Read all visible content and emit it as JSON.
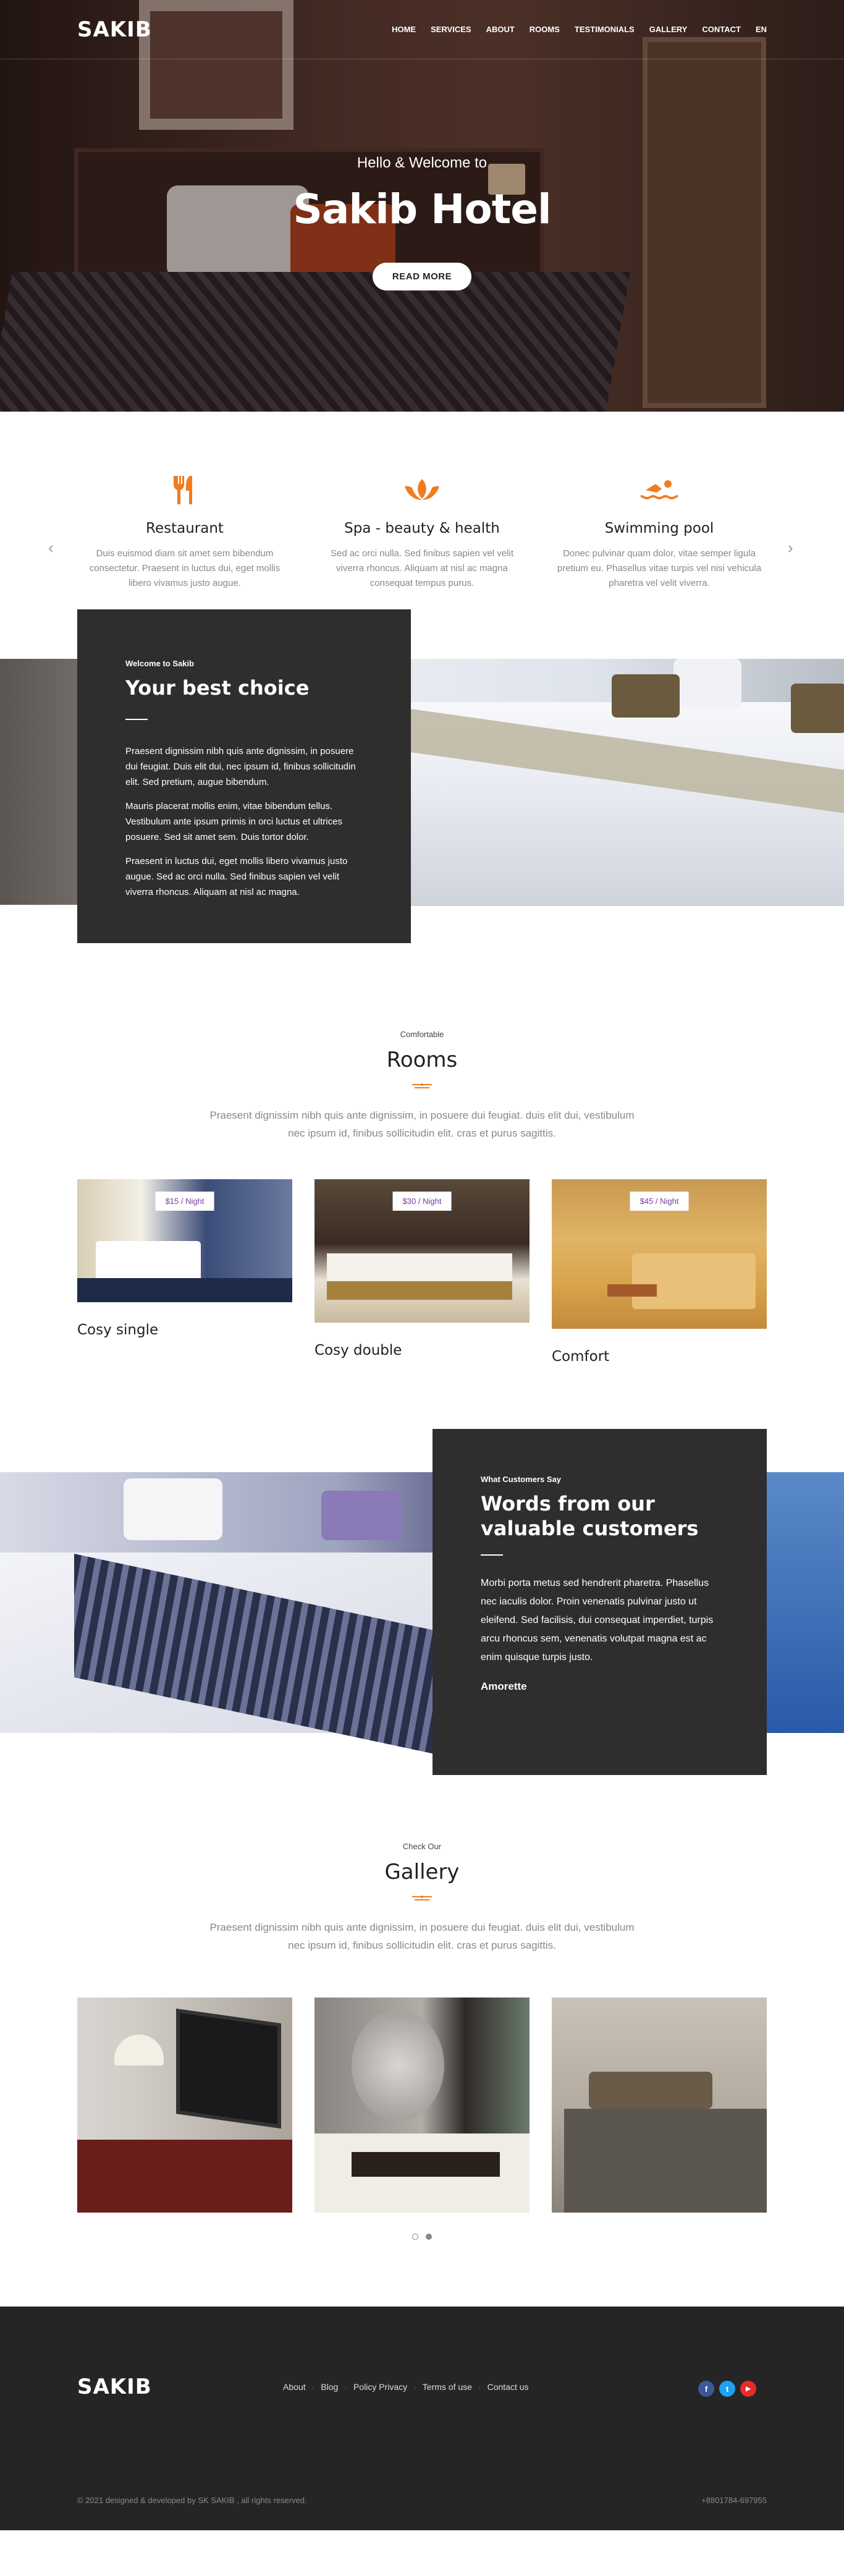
{
  "nav": {
    "logo": "SAKIB",
    "items": [
      "HOME",
      "SERVICES",
      "ABOUT",
      "ROOMS",
      "TESTIMONIALS",
      "GALLERY",
      "CONTACT",
      "EN"
    ]
  },
  "hero": {
    "subtitle": "Hello & Welcome to",
    "title": "Sakib Hotel",
    "button": "READ MORE"
  },
  "services": [
    {
      "icon": "fork-knife-icon",
      "title": "Restaurant",
      "text": "Duis euismod diam sit amet sem bibendum consectetur. Praesent in luctus dui, eget mollis libero vivamus justo augue."
    },
    {
      "icon": "lotus-icon",
      "title": "Spa - beauty & health",
      "text": "Sed ac orci nulla. Sed finibus sapien vel velit viverra rhoncus. Aliquam at nisl ac magna consequat tempus purus."
    },
    {
      "icon": "swimmer-icon",
      "title": "Swimming pool",
      "text": "Donec pulvinar quam dolor, vitae semper ligula pretium eu. Phasellus vitae turpis vel nisi vehicula pharetra vel velit viverra."
    }
  ],
  "about": {
    "small": "Welcome to Sakib",
    "title": "Your best choice",
    "paragraphs": [
      "Praesent dignissim nibh quis ante dignissim, in posuere dui feugiat. Duis elit dui, nec ipsum id, finibus sollicitudin elit. Sed pretium, augue bibendum.",
      "Mauris placerat mollis enim, vitae bibendum tellus. Vestibulum ante ipsum primis in orci luctus et ultrices posuere. Sed sit amet sem. Duis tortor dolor.",
      "Praesent in luctus dui, eget mollis libero vivamus justo augue. Sed ac orci nulla. Sed finibus sapien vel velit viverra rhoncus. Aliquam at nisl ac magna."
    ]
  },
  "rooms": {
    "small": "Comfortable",
    "title": "Rooms",
    "text": "Praesent dignissim nibh quis ante dignissim, in posuere dui feugiat. duis elit dui, vestibulum nec ipsum id, finibus sollicitudin elit. cras et purus sagittis.",
    "items": [
      {
        "price": "$15 / Night",
        "name": "Cosy single"
      },
      {
        "price": "$30 / Night",
        "name": "Cosy double"
      },
      {
        "price": "$45 / Night",
        "name": "Comfort"
      }
    ]
  },
  "testimonial": {
    "small": "What Customers Say",
    "title": "Words from our valuable customers",
    "text": "Morbi porta metus sed hendrerit pharetra. Phasellus nec iaculis dolor. Proin venenatis pulvinar justo ut eleifend. Sed facilisis, dui consequat imperdiet, turpis arcu rhoncus sem, venenatis volutpat magna est ac enim quisque turpis justo.",
    "author": "Amorette"
  },
  "gallery": {
    "small": "Check Our",
    "title": "Gallery",
    "text": "Praesent dignissim nibh quis ante dignissim, in posuere dui feugiat. duis elit dui, vestibulum nec ipsum id, finibus sollicitudin elit. cras et purus sagittis."
  },
  "footer": {
    "logo": "SAKIB",
    "links": [
      "About",
      "Blog",
      "Policy Privacy",
      "Terms of use",
      "Contact us"
    ],
    "socials": [
      {
        "icon": "facebook-icon",
        "glyph": "f",
        "color": "#3b5998"
      },
      {
        "icon": "twitter-icon",
        "glyph": "t",
        "color": "#1da1f2"
      },
      {
        "icon": "youtube-icon",
        "glyph": "▶",
        "color": "#e52d27"
      }
    ],
    "copyright": "© 2021 designed & developed by SK SAKIB , all rights reserved.",
    "phone": "+8801784-697955"
  },
  "colors": {
    "accent": "#f07c1e",
    "dark": "#2e2e2e",
    "footer": "#252525",
    "price": "#7a3a9a"
  }
}
